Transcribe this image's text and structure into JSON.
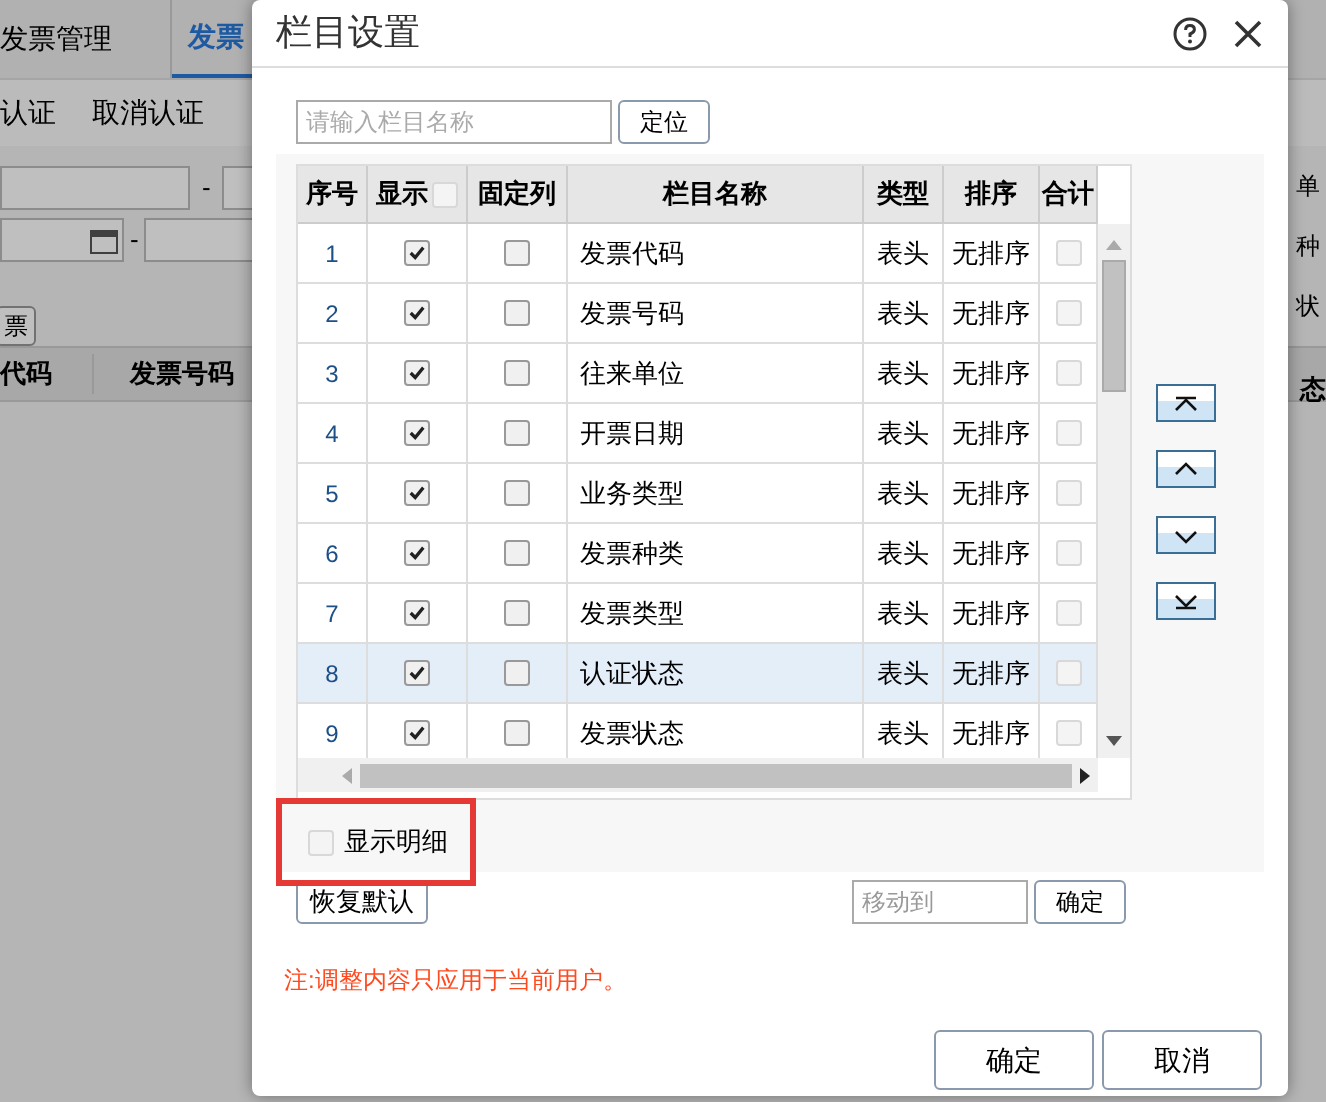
{
  "background": {
    "tabs": [
      {
        "label": "发票管理",
        "selected": false
      },
      {
        "label": "发票",
        "selected": true
      }
    ],
    "toolbar": [
      "认证",
      "取消认证"
    ],
    "date_separators": [
      "-",
      "-"
    ],
    "button": "票",
    "columns": [
      "代码",
      "发票号码"
    ],
    "right_labels": [
      "单",
      "种",
      "状"
    ],
    "right_column": "态"
  },
  "dialog": {
    "title": "栏目设置",
    "search": {
      "placeholder": "请输入栏目名称",
      "button": "定位"
    },
    "table": {
      "columns": [
        "序号",
        "显示",
        "固定列",
        "栏目名称",
        "类型",
        "排序",
        "合计"
      ],
      "show_all_checked": false,
      "rows": [
        {
          "index": "1",
          "show": true,
          "fixed": false,
          "name": "发票代码",
          "type": "表头",
          "sort": "无排序",
          "sum": false,
          "selected": false
        },
        {
          "index": "2",
          "show": true,
          "fixed": false,
          "name": "发票号码",
          "type": "表头",
          "sort": "无排序",
          "sum": false,
          "selected": false
        },
        {
          "index": "3",
          "show": true,
          "fixed": false,
          "name": "往来单位",
          "type": "表头",
          "sort": "无排序",
          "sum": false,
          "selected": false
        },
        {
          "index": "4",
          "show": true,
          "fixed": false,
          "name": "开票日期",
          "type": "表头",
          "sort": "无排序",
          "sum": false,
          "selected": false
        },
        {
          "index": "5",
          "show": true,
          "fixed": false,
          "name": "业务类型",
          "type": "表头",
          "sort": "无排序",
          "sum": false,
          "selected": false
        },
        {
          "index": "6",
          "show": true,
          "fixed": false,
          "name": "发票种类",
          "type": "表头",
          "sort": "无排序",
          "sum": false,
          "selected": false
        },
        {
          "index": "7",
          "show": true,
          "fixed": false,
          "name": "发票类型",
          "type": "表头",
          "sort": "无排序",
          "sum": false,
          "selected": false
        },
        {
          "index": "8",
          "show": true,
          "fixed": false,
          "name": "认证状态",
          "type": "表头",
          "sort": "无排序",
          "sum": false,
          "selected": true
        },
        {
          "index": "9",
          "show": true,
          "fixed": false,
          "name": "发票状态",
          "type": "表头",
          "sort": "无排序",
          "sum": false,
          "selected": false
        }
      ]
    },
    "detail_option": {
      "label": "显示明细",
      "checked": false,
      "highlighted": true
    },
    "reset_button": "恢复默认",
    "move_to": {
      "placeholder": "移动到",
      "button": "确定"
    },
    "note": "注:调整内容只应用于当前用户。",
    "buttons": [
      "确定",
      "取消"
    ]
  }
}
